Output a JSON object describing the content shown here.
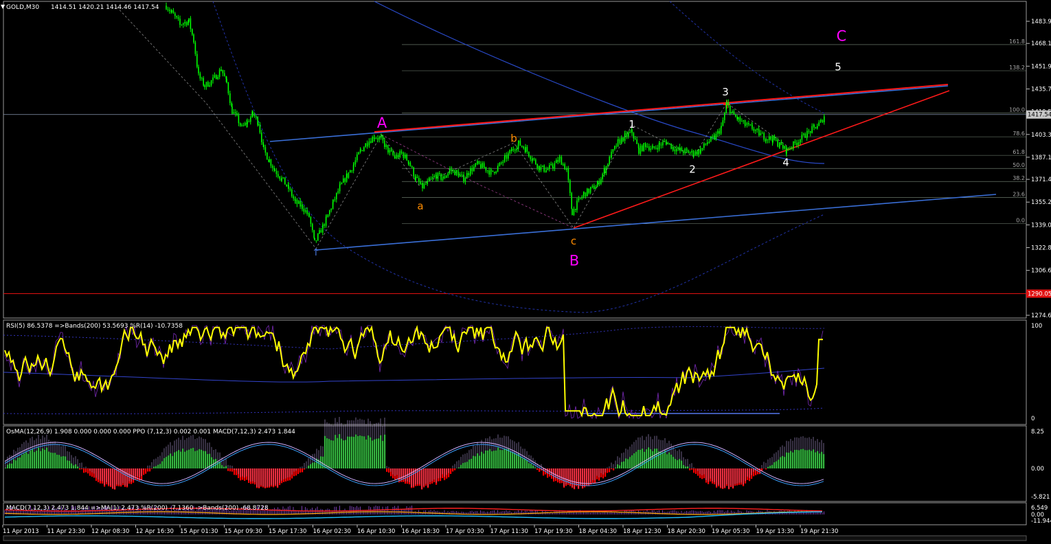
{
  "header": {
    "symbol_label": "GOLD,M30",
    "ohlc": "1414.51 1420.21 1414.46 1417.54"
  },
  "colors": {
    "background": "#000000",
    "grid": "#c0c0c0",
    "candle": "#00ff00",
    "wave_label_major": "#ff00ff",
    "wave_label_minor": "#ff8c00",
    "wave_label_impulse": "#ffffff",
    "channel_red": "#ff1a1a",
    "channel_blue": "#3a6fd8",
    "rsi_line": "#ffff00",
    "macd_green": "#00c000",
    "macd_red": "#ff0000"
  },
  "chart_data": [
    {
      "type": "candlestick",
      "panel": "main",
      "ylim": [
        1274.65,
        1495
      ],
      "price_ticks": [
        "1483.90",
        "1468.15",
        "1451.95",
        "1435.75",
        "1419.55",
        "1403.35",
        "1387.15",
        "1371.40",
        "1355.20",
        "1339.00",
        "1322.80",
        "1306.60",
        "1290.05",
        "1274.65"
      ],
      "current_price_tag": "1417.54",
      "level_tag": "1290.05",
      "fib_levels": [
        {
          "label": "161.8",
          "price": 1467.3
        },
        {
          "label": "138.2",
          "price": 1448.7
        },
        {
          "label": "100.0",
          "price": 1418.6
        },
        {
          "label": "78.6",
          "price": 1401.7
        },
        {
          "label": "61.8",
          "price": 1388.5
        },
        {
          "label": "50.0",
          "price": 1379.2
        },
        {
          "label": "38.2",
          "price": 1369.9
        },
        {
          "label": "23.6",
          "price": 1358.4
        },
        {
          "label": "0.0",
          "price": 1339.8
        }
      ],
      "close_path": [
        [
          242,
          1495
        ],
        [
          250,
          1490
        ],
        [
          262,
          1482
        ],
        [
          275,
          1484
        ],
        [
          282,
          1470
        ],
        [
          289,
          1445
        ],
        [
          298,
          1438
        ],
        [
          310,
          1442
        ],
        [
          322,
          1450
        ],
        [
          330,
          1440
        ],
        [
          338,
          1420
        ],
        [
          345,
          1415
        ],
        [
          352,
          1408
        ],
        [
          360,
          1412
        ],
        [
          368,
          1418
        ],
        [
          376,
          1412
        ],
        [
          384,
          1392
        ],
        [
          392,
          1385
        ],
        [
          400,
          1378
        ],
        [
          410,
          1372
        ],
        [
          420,
          1365
        ],
        [
          430,
          1355
        ],
        [
          440,
          1352
        ],
        [
          450,
          1345
        ],
        [
          458,
          1326
        ],
        [
          465,
          1333
        ],
        [
          475,
          1343
        ],
        [
          485,
          1355
        ],
        [
          495,
          1366
        ],
        [
          505,
          1374
        ],
        [
          515,
          1382
        ],
        [
          525,
          1392
        ],
        [
          535,
          1398
        ],
        [
          545,
          1402
        ],
        [
          555,
          1400
        ],
        [
          565,
          1392
        ],
        [
          575,
          1387
        ],
        [
          585,
          1390
        ],
        [
          595,
          1384
        ],
        [
          605,
          1372
        ],
        [
          615,
          1366
        ],
        [
          625,
          1370
        ],
        [
          635,
          1374
        ],
        [
          645,
          1372
        ],
        [
          655,
          1378
        ],
        [
          665,
          1376
        ],
        [
          675,
          1372
        ],
        [
          685,
          1378
        ],
        [
          695,
          1382
        ],
        [
          705,
          1380
        ],
        [
          715,
          1376
        ],
        [
          725,
          1380
        ],
        [
          735,
          1386
        ],
        [
          745,
          1392
        ],
        [
          755,
          1397
        ],
        [
          765,
          1393
        ],
        [
          775,
          1386
        ],
        [
          785,
          1380
        ],
        [
          795,
          1378
        ],
        [
          805,
          1381
        ],
        [
          815,
          1386
        ],
        [
          825,
          1378
        ],
        [
          833,
          1348
        ],
        [
          840,
          1354
        ],
        [
          850,
          1361
        ],
        [
          860,
          1364
        ],
        [
          870,
          1368
        ],
        [
          880,
          1378
        ],
        [
          890,
          1389
        ],
        [
          900,
          1398
        ],
        [
          910,
          1402
        ],
        [
          920,
          1405
        ],
        [
          930,
          1392
        ],
        [
          940,
          1396
        ],
        [
          950,
          1393
        ],
        [
          960,
          1396
        ],
        [
          970,
          1398
        ],
        [
          980,
          1394
        ],
        [
          990,
          1392
        ],
        [
          1000,
          1391
        ],
        [
          1010,
          1390
        ],
        [
          1020,
          1392
        ],
        [
          1030,
          1398
        ],
        [
          1040,
          1401
        ],
        [
          1050,
          1408
        ],
        [
          1058,
          1425
        ],
        [
          1066,
          1418
        ],
        [
          1075,
          1414
        ],
        [
          1085,
          1410
        ],
        [
          1095,
          1408
        ],
        [
          1105,
          1404
        ],
        [
          1115,
          1401
        ],
        [
          1125,
          1400
        ],
        [
          1135,
          1396
        ],
        [
          1145,
          1392
        ],
        [
          1155,
          1396
        ],
        [
          1165,
          1400
        ],
        [
          1175,
          1404
        ],
        [
          1185,
          1408
        ],
        [
          1195,
          1412
        ],
        [
          1200,
          1417
        ]
      ],
      "wave_labels": [
        {
          "text": "A",
          "color": "#ff00ff",
          "price": 1408
        },
        {
          "text": "B",
          "color": "#ff00ff",
          "price": 1310
        },
        {
          "text": "C",
          "color": "#ff00ff",
          "price": 1470
        },
        {
          "text": "a",
          "color": "#ff8c00",
          "price": 1350
        },
        {
          "text": "b",
          "color": "#ff8c00",
          "price": 1398
        },
        {
          "text": "c",
          "color": "#ff8c00",
          "price": 1325
        },
        {
          "text": "1",
          "color": "#ffffff",
          "price": 1408
        },
        {
          "text": "2",
          "color": "#ffffff",
          "price": 1376
        },
        {
          "text": "3",
          "color": "#ffffff",
          "price": 1431
        },
        {
          "text": "4",
          "color": "#ffffff",
          "price": 1381
        },
        {
          "text": "5",
          "color": "#ffffff",
          "price": 1449
        }
      ]
    },
    {
      "type": "line",
      "panel": "rsi",
      "legend": "RSI(5) 86.5378  =>Bands(200) 53.5693  %R(14) -10.7358",
      "ylim": [
        0,
        100
      ],
      "ticks": [
        "100",
        "0"
      ]
    },
    {
      "type": "bar",
      "panel": "osma",
      "legend": "OsMA(12,26,9) 1.908 0.000 0.000 0.000  PPO (7,12,3) 0.002 0.001  MACD(7,12,3) 2.473 1.844",
      "ticks": [
        "8.25",
        "0.00",
        "-5.821"
      ]
    },
    {
      "type": "line",
      "panel": "macd",
      "legend": "MACD(7,12,3) 2.473 1.844  =>MA(1) 2.473  %R(200) -7.1360  ->Bands(200) -68.8728",
      "ticks": [
        "6.549",
        "0.00",
        "-11.944"
      ]
    }
  ],
  "time_axis": [
    "11 Apr 2013",
    "11 Apr 23:30",
    "12 Apr 08:30",
    "12 Apr 16:30",
    "15 Apr 01:30",
    "15 Apr 09:30",
    "15 Apr 17:30",
    "16 Apr 02:30",
    "16 Apr 10:30",
    "16 Apr 18:30",
    "17 Apr 03:30",
    "17 Apr 11:30",
    "17 Apr 19:30",
    "18 Apr 04:30",
    "18 Apr 12:30",
    "18 Apr 20:30",
    "19 Apr 05:30",
    "19 Apr 13:30",
    "19 Apr 21:30"
  ]
}
